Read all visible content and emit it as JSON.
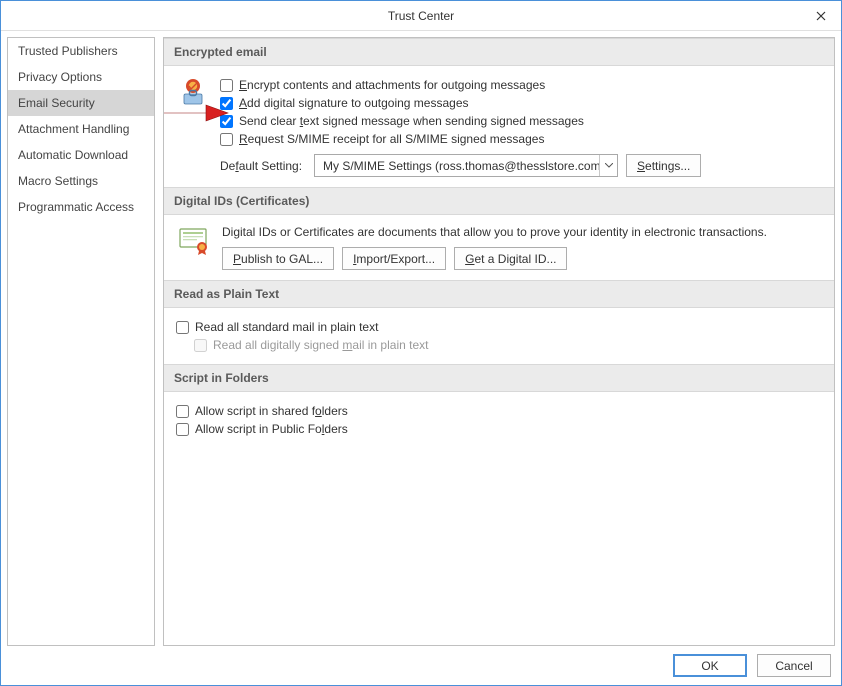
{
  "titlebar": {
    "title": "Trust Center"
  },
  "sidebar": {
    "items": [
      {
        "label": "Trusted Publishers"
      },
      {
        "label": "Privacy Options"
      },
      {
        "label": "Email Security",
        "selected": true
      },
      {
        "label": "Attachment Handling"
      },
      {
        "label": "Automatic Download"
      },
      {
        "label": "Macro Settings"
      },
      {
        "label": "Programmatic Access"
      }
    ]
  },
  "encrypted": {
    "header": "Encrypted email",
    "opt_encrypt": "Encrypt contents and attachments for outgoing messages",
    "opt_encrypt_checked": false,
    "opt_sign": "Add digital signature to outgoing messages",
    "opt_sign_checked": true,
    "opt_cleartext": "Send clear text signed message when sending signed messages",
    "opt_cleartext_checked": true,
    "opt_receipt": "Request S/MIME receipt for all S/MIME signed messages",
    "opt_receipt_checked": false,
    "default_label": "Default Setting:",
    "default_value": "My S/MIME Settings (ross.thomas@thesslstore.com)",
    "settings_btn": "Settings..."
  },
  "digitalids": {
    "header": "Digital IDs (Certificates)",
    "description": "Digital IDs or Certificates are documents that allow you to prove your identity in electronic transactions.",
    "publish_btn": "Publish to GAL...",
    "import_btn": "Import/Export...",
    "get_btn": "Get a Digital ID..."
  },
  "plaintext": {
    "header": "Read as Plain Text",
    "opt_read_plain": "Read all standard mail in plain text",
    "opt_read_plain_checked": false,
    "opt_read_signed_plain": "Read all digitally signed mail in plain text",
    "opt_read_signed_plain_disabled": true
  },
  "script": {
    "header": "Script in Folders",
    "opt_shared": "Allow script in shared folders",
    "opt_shared_checked": false,
    "opt_public": "Allow script in Public Folders",
    "opt_public_checked": false
  },
  "buttons": {
    "ok": "OK",
    "cancel": "Cancel"
  }
}
